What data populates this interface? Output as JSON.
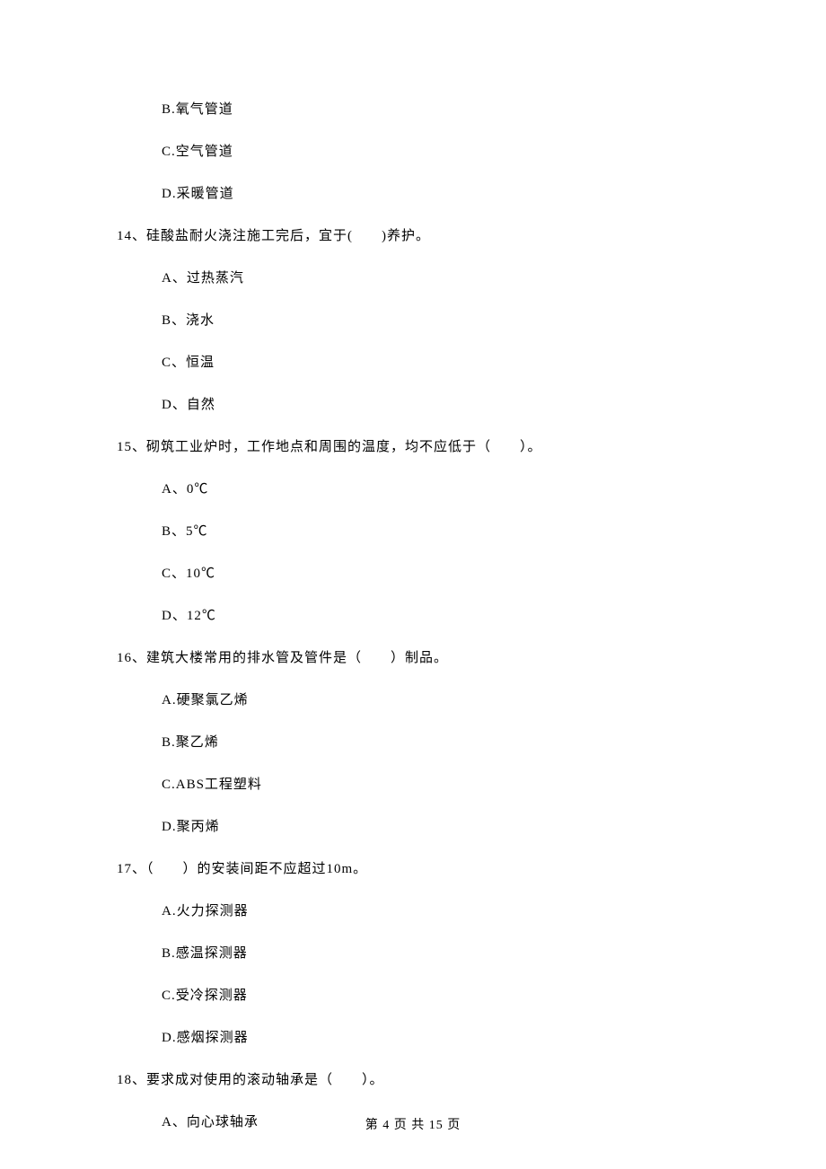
{
  "options_prev": [
    "B.氧气管道",
    "C.空气管道",
    "D.采暖管道"
  ],
  "q14": {
    "stem": "14、硅酸盐耐火浇注施工完后，宜于(　　)养护。",
    "opts": [
      "A、过热蒸汽",
      "B、浇水",
      "C、恒温",
      "D、自然"
    ]
  },
  "q15": {
    "stem": "15、砌筑工业炉时，工作地点和周围的温度，均不应低于（　　）。",
    "opts": [
      "A、0℃",
      "B、5℃",
      "C、10℃",
      "D、12℃"
    ]
  },
  "q16": {
    "stem": "16、建筑大楼常用的排水管及管件是（　　）制品。",
    "opts": [
      "A.硬聚氯乙烯",
      "B.聚乙烯",
      "C.ABS工程塑料",
      "D.聚丙烯"
    ]
  },
  "q17": {
    "stem": "17、（　　）的安装间距不应超过10m。",
    "opts": [
      "A.火力探测器",
      "B.感温探测器",
      "C.受冷探测器",
      "D.感烟探测器"
    ]
  },
  "q18": {
    "stem": "18、要求成对使用的滚动轴承是（　　）。",
    "opts": [
      "A、向心球轴承"
    ]
  },
  "footer": "第 4 页 共 15 页"
}
